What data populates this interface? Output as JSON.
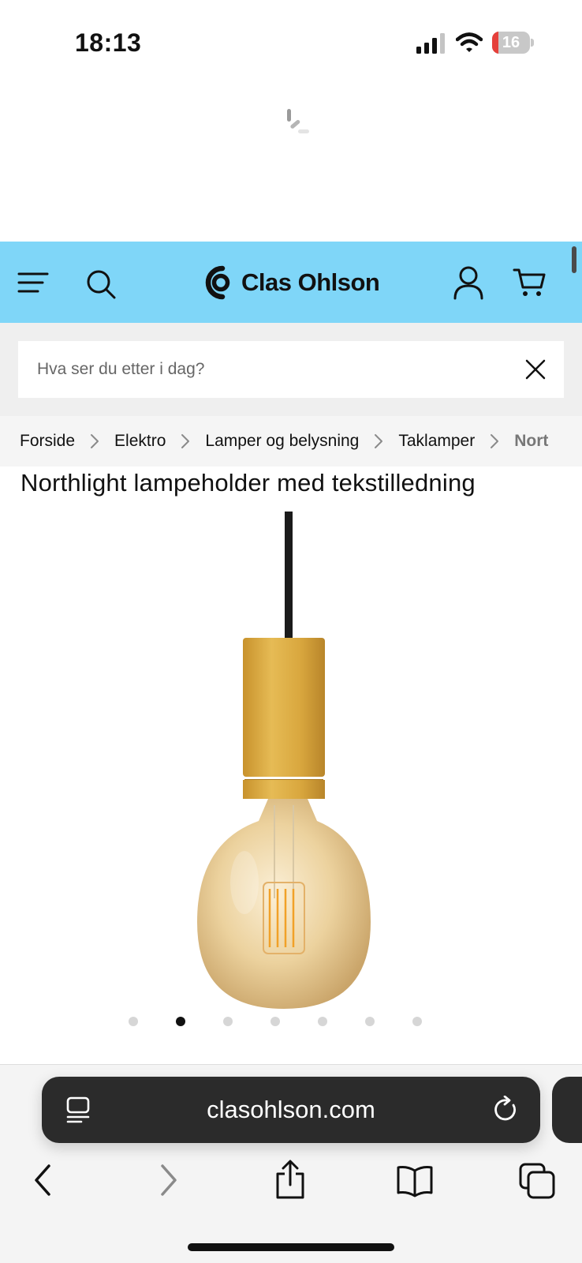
{
  "status_bar": {
    "time": "18:13",
    "battery_level": "16",
    "battery_fraction": 0.16,
    "icons": [
      "signal-icon",
      "wifi-icon",
      "battery-icon"
    ]
  },
  "header": {
    "logo_text": "Clas Ohlson",
    "background_color": "#7fd6f8",
    "icons": [
      "menu-icon",
      "search-icon",
      "account-icon",
      "cart-icon"
    ]
  },
  "search": {
    "placeholder": "Hva ser du etter i dag?",
    "value": ""
  },
  "breadcrumb": {
    "items": [
      "Forside",
      "Elektro",
      "Lamper og belysning",
      "Taklamper"
    ],
    "current": "Nort"
  },
  "product": {
    "title": "Northlight lampeholder med tekstilledning",
    "image_icon": "pendant-lamp-bulb-image",
    "accent_color": "#d9a73e"
  },
  "carousel": {
    "total": 7,
    "active_index": 1
  },
  "browser": {
    "url": "clasohlson.com",
    "icons": [
      "reader-icon",
      "reload-icon",
      "back-icon",
      "forward-icon",
      "share-icon",
      "bookmarks-icon",
      "tabs-icon"
    ]
  }
}
